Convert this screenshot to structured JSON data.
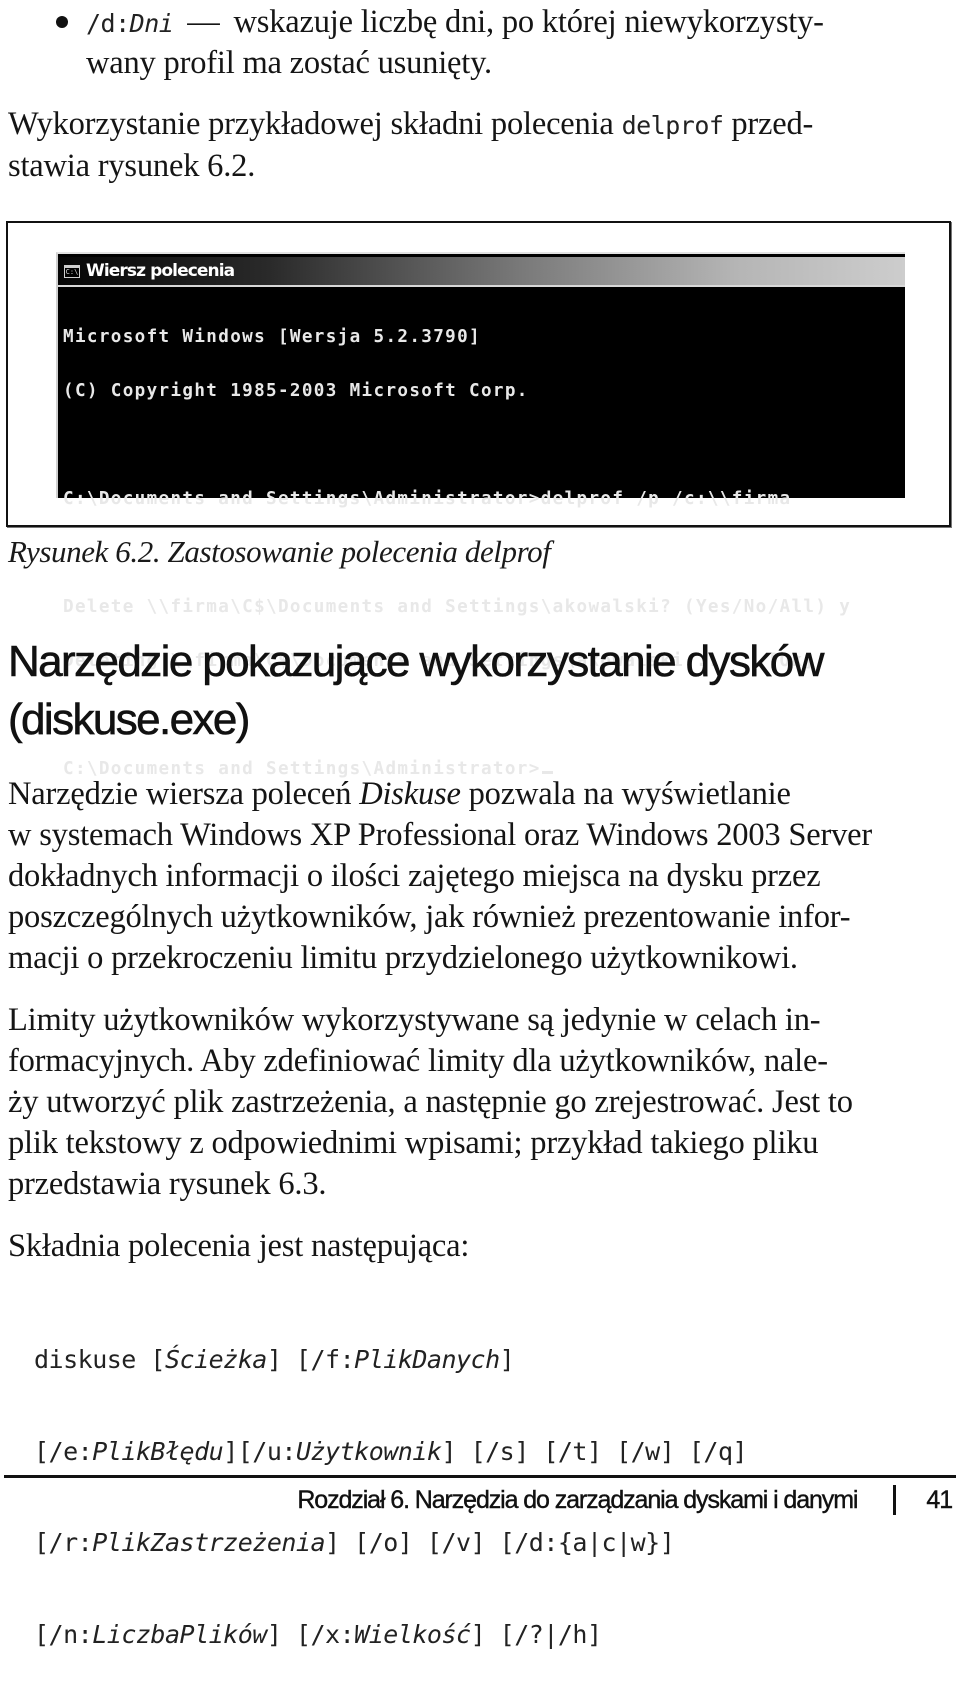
{
  "bullet_item": {
    "code_flag": "/d:",
    "code_param": "Dni",
    "dash": "—",
    "text_line1": "wskazuje liczbę dni, po której niewykorzysty-",
    "text_line2": "wany profil ma zostać usunięty."
  },
  "intro_paragraph": {
    "text_before": "Wykorzystanie przykładowej składni polecenia",
    "code": "delprof",
    "text_after": "przed-",
    "line2": "stawia rysunek 6.2."
  },
  "figure": {
    "window_title": "Wiersz polecenia",
    "window_icon": "cmd-icon",
    "icon_text": "C:\\",
    "terminal_lines": [
      "Microsoft Windows [Wersja 5.2.3790]",
      "(C) Copyright 1985-2003 Microsoft Corp.",
      "",
      "C:\\Documents and Settings\\Administrator>delprof /p /c:\\\\firma",
      "",
      "Delete \\\\firma\\C$\\Documents and Settings\\akowalski? (Yes/No/All) y",
      "Deleting \\\\firma\\C$\\Documents and Settings\\akowalski...    [Ok]",
      "",
      "C:\\Documents and Settings\\Administrator>"
    ],
    "caption": "Rysunek 6.2. Zastosowanie polecenia delprof"
  },
  "section": {
    "heading_line1": "Narzędzie pokazujące wykorzystanie dysków",
    "heading_line2": "(diskuse.exe)",
    "paragraph1": {
      "before_italic": "Narzędzie wiersza poleceń",
      "italic": "Diskuse",
      "line1_rest": "pozwala na wyświetlanie",
      "lines": [
        "w systemach Windows XP Professional oraz Windows 2003 Server",
        "dokładnych informacji o ilości zajętego miejsca na dysku przez",
        "poszczególnych użytkowników, jak również prezentowanie infor-",
        "macji o przekroczeniu limitu przydzielonego użytkownikowi."
      ]
    },
    "paragraph2": {
      "lines": [
        "Limity użytkowników wykorzystywane są jedynie w celach in-",
        "formacyjnych. Aby zdefiniować limity dla użytkowników, nale-",
        "ży utworzyć plik zastrzeżenia, a następnie go zrejestrować. Jest to",
        "plik tekstowy z odpowiednimi wpisami; przykład takiego pliku",
        "przedstawia rysunek 6.3."
      ]
    },
    "paragraph3": "Składnia polecenia jest następująca:",
    "syntax": {
      "line1": {
        "cmd": "diskuse [",
        "p1": "Ścieżka",
        "m1": "] [/f:",
        "p2": "PlikDanych",
        "m2": "]"
      },
      "line2": {
        "a": "[/e:",
        "p1": "PlikBłędu",
        "b": "][/u:",
        "p2": "Użytkownik",
        "c": "] [/s] [/t] [/w] [/q]"
      },
      "line3": {
        "a": "[/r:",
        "p1": "PlikZastrzeżenia",
        "b": "] [/o] [/v] [/d:{a|c|w}]"
      },
      "line4": {
        "a": "[/n:",
        "p1": "LiczbaPlików",
        "b": "] [/x:",
        "p2": "Wielkość",
        "c": "] [/?|/h]"
      }
    }
  },
  "footer": {
    "chapter": "Rozdział 6. Narzędzia do zarządzania dyskami i danymi",
    "page_number": "41"
  }
}
